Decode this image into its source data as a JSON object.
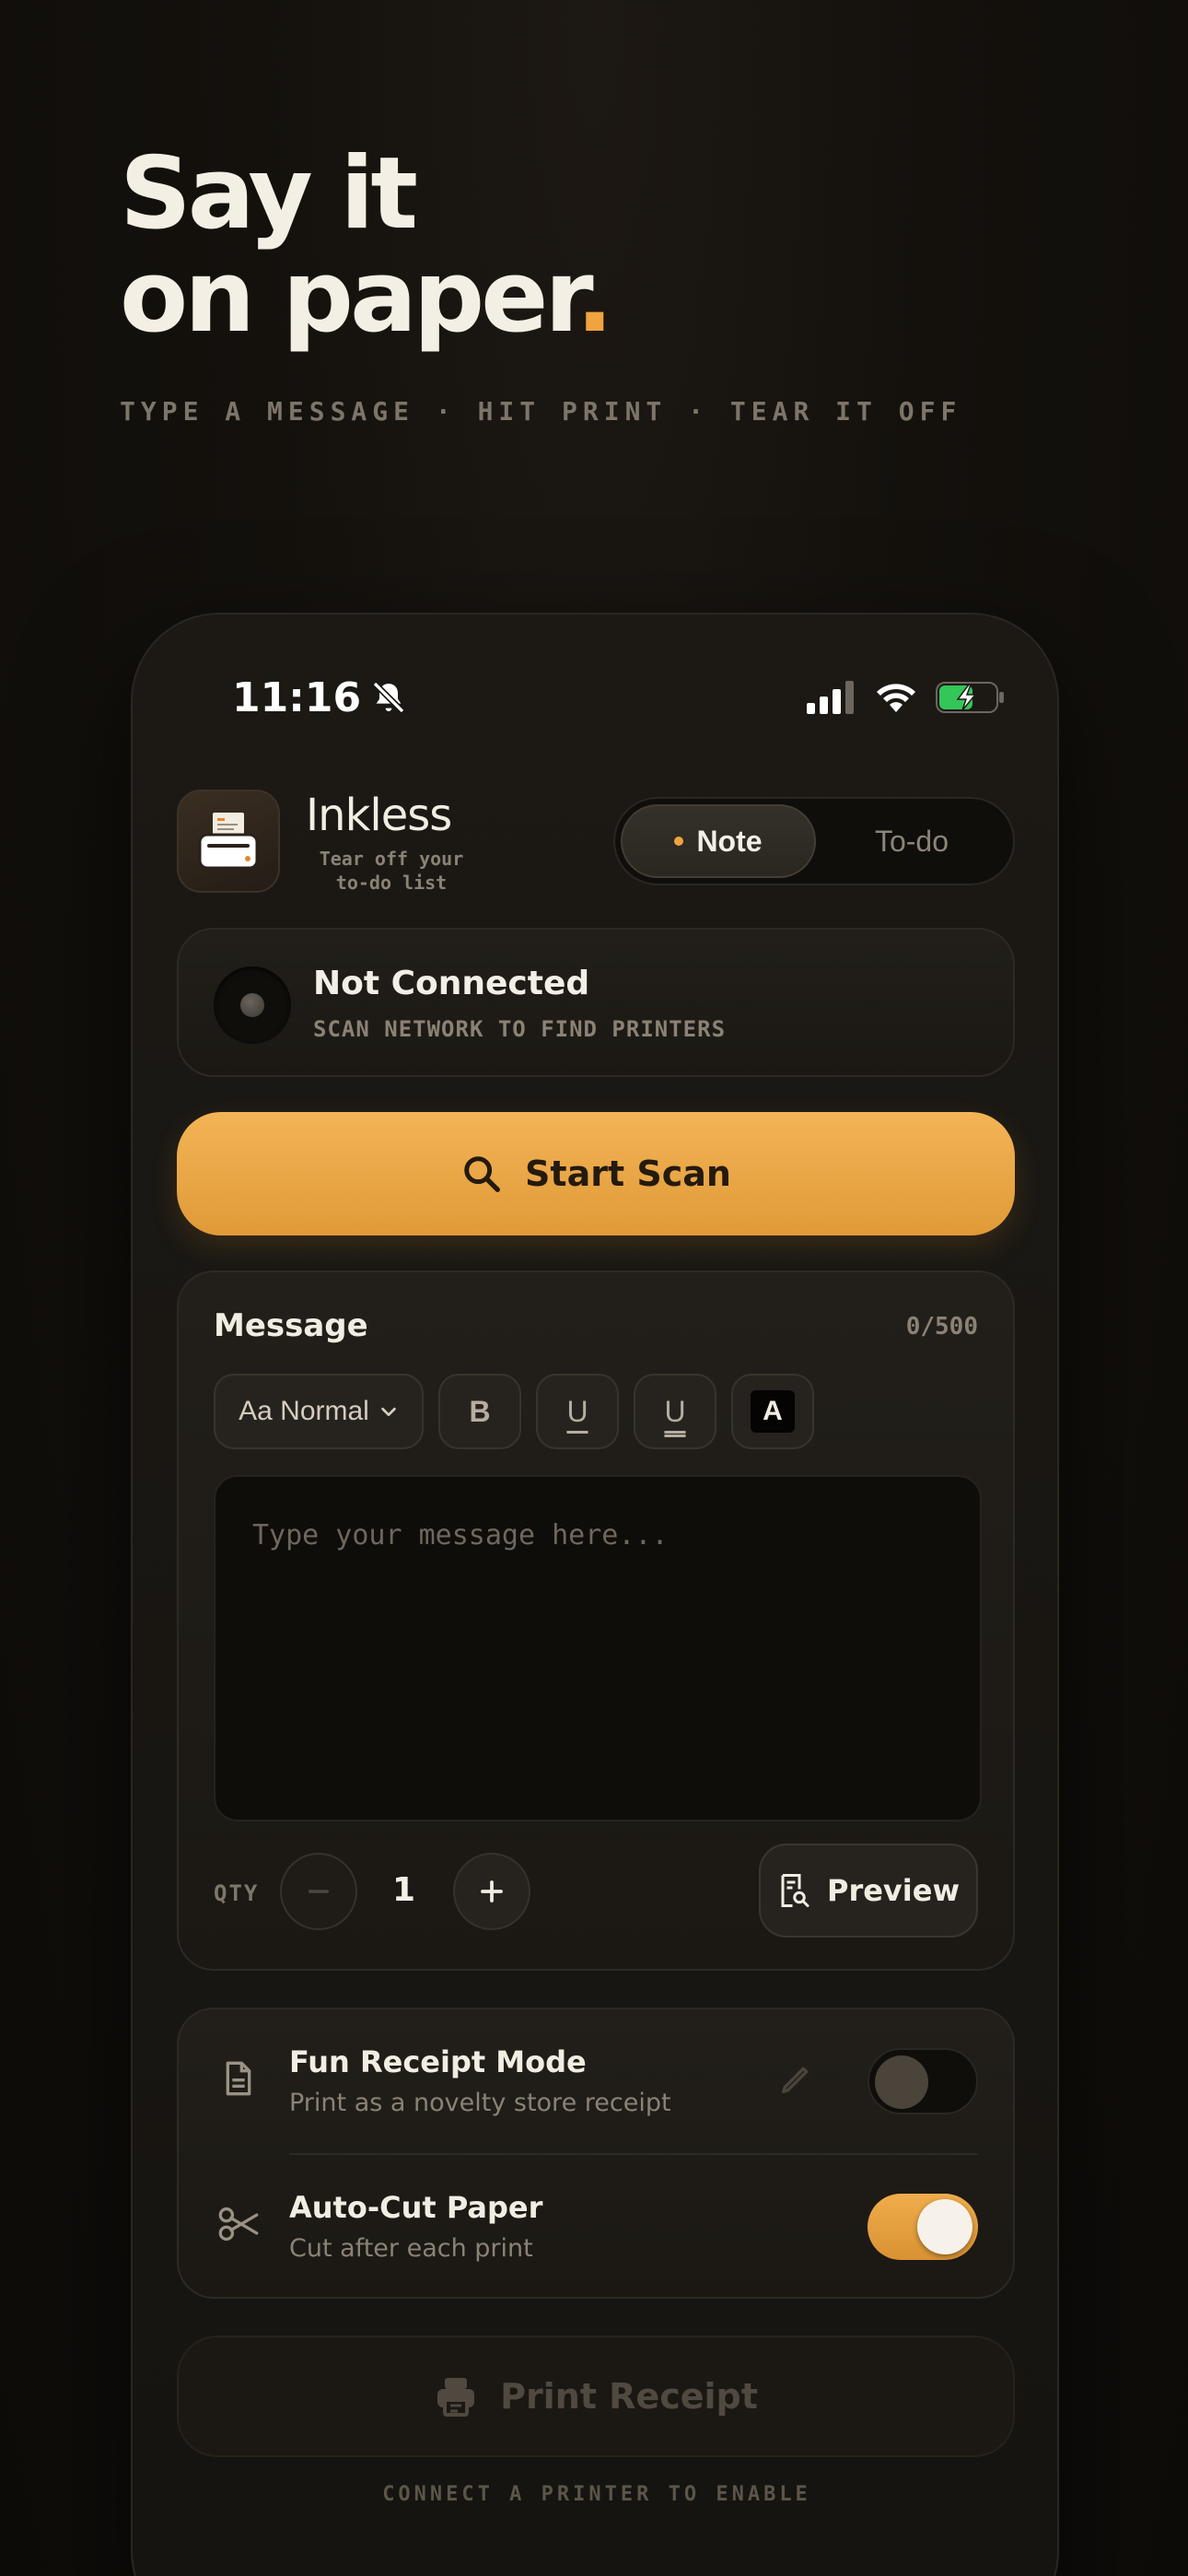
{
  "hero": {
    "title_line1": "Say it",
    "title_line2": "on paper",
    "title_dot": ".",
    "subtitle": "TYPE A MESSAGE · HIT PRINT · TEAR IT OFF"
  },
  "status_bar": {
    "time": "11:16",
    "icons": [
      "bell-slash-icon",
      "cellular-signal-icon",
      "wifi-icon",
      "battery-charging-icon"
    ]
  },
  "app": {
    "name": "Inkless",
    "tagline": "Tear off your to-do list",
    "icon": "printer-icon"
  },
  "mode_tabs": [
    {
      "label": "Note",
      "active": true
    },
    {
      "label": "To-do",
      "active": false
    }
  ],
  "connection": {
    "title": "Not Connected",
    "subtitle": "SCAN NETWORK TO FIND PRINTERS"
  },
  "scan_button": {
    "label": "Start Scan",
    "icon": "search-icon"
  },
  "message": {
    "label": "Message",
    "count": "0/500",
    "placeholder": "Type your message here...",
    "format": {
      "size_select": "Aa Normal",
      "bold": "B",
      "underline": "U",
      "double_underline": "U",
      "invert": "A"
    },
    "qty_label": "QTY",
    "qty_value": "1",
    "preview_label": "Preview"
  },
  "options": [
    {
      "title": "Fun Receipt Mode",
      "subtitle": "Print as a novelty store receipt",
      "icon": "document-icon",
      "enabled": false
    },
    {
      "title": "Auto-Cut Paper",
      "subtitle": "Cut after each print",
      "icon": "scissors-icon",
      "enabled": true
    }
  ],
  "print": {
    "label": "Print Receipt",
    "hint": "CONNECT A PRINTER TO ENABLE",
    "icon": "printer-icon"
  },
  "colors": {
    "accent": "#f0a33e",
    "background": "#14110d",
    "card": "#1e1b17"
  }
}
